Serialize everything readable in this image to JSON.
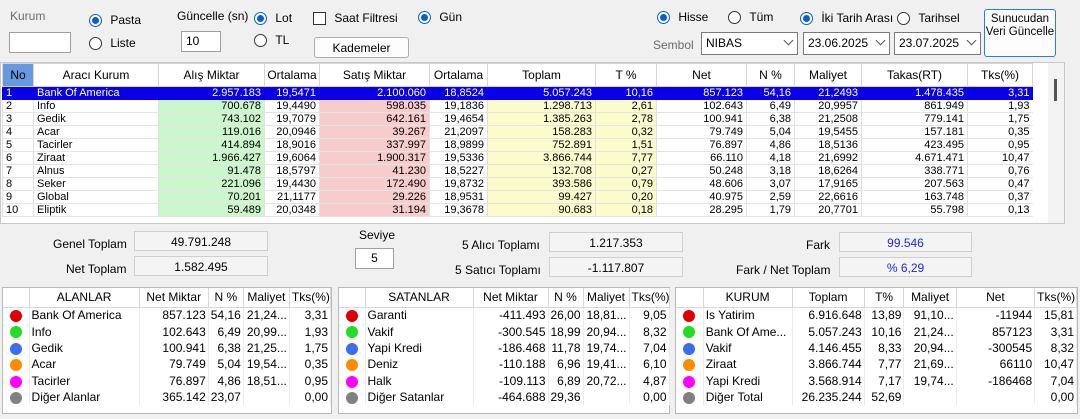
{
  "toolbar": {
    "kurum_label": "Kurum",
    "kurum_value": "",
    "pasta_label": "Pasta",
    "liste_label": "Liste",
    "guncelle_label": "Güncelle (sn)",
    "guncelle_value": "10",
    "lot_label": "Lot",
    "tl_label": "TL",
    "saat_filtresi_label": "Saat Filtresi",
    "gun_label": "Gün",
    "kademeler_label": "Kademeler",
    "hisse_label": "Hisse",
    "tum_label": "Tüm",
    "iki_tarih_label": "İki Tarih Arası",
    "tarihsel_label": "Tarihsel",
    "sembol_label": "Sembol",
    "sembol_value": "NIBAS",
    "date_from": "23.06.2025",
    "date_to": "23.07.2025",
    "server_btn": "Sunucudan Veri Güncelle"
  },
  "grid": {
    "headers": [
      "No",
      "Aracı Kurum",
      "Alış Miktar",
      "Ortalama",
      "Satış Miktar",
      "Ortalama",
      "Toplam",
      "T %",
      "Net",
      "N %",
      "Maliyet",
      "Takas(RT)",
      "Tks(%)"
    ],
    "rows": [
      [
        "1",
        "Bank Of America",
        "2.957.183",
        "19,5471",
        "2.100.060",
        "18,8524",
        "5.057.243",
        "10,16",
        "857.123",
        "54,16",
        "21,2493",
        "1.478.435",
        "3,31"
      ],
      [
        "2",
        "Info",
        "700.678",
        "19,4490",
        "598.035",
        "19,1836",
        "1.298.713",
        "2,61",
        "102.643",
        "6,49",
        "20,9957",
        "861.949",
        "1,93"
      ],
      [
        "3",
        "Gedik",
        "743.102",
        "19,7079",
        "642.161",
        "19,4654",
        "1.385.263",
        "2,78",
        "100.941",
        "6,38",
        "21,2508",
        "779.141",
        "1,75"
      ],
      [
        "4",
        "Acar",
        "119.016",
        "20,0946",
        "39.267",
        "21,2097",
        "158.283",
        "0,32",
        "79.749",
        "5,04",
        "19,5455",
        "157.181",
        "0,35"
      ],
      [
        "5",
        "Tacirler",
        "414.894",
        "18,9016",
        "337.997",
        "18,9899",
        "752.891",
        "1,51",
        "76.897",
        "4,86",
        "18,5136",
        "423.495",
        "0,95"
      ],
      [
        "6",
        "Ziraat",
        "1.966.427",
        "19,6064",
        "1.900.317",
        "19,5336",
        "3.866.744",
        "7,77",
        "66.110",
        "4,18",
        "21,6992",
        "4.671.471",
        "10,47"
      ],
      [
        "7",
        "Alnus",
        "91.478",
        "18,5797",
        "41.230",
        "18,5227",
        "132.708",
        "0,27",
        "50.248",
        "3,18",
        "18,6264",
        "338.771",
        "0,76"
      ],
      [
        "8",
        "Seker",
        "221.096",
        "19,4430",
        "172.490",
        "19,8732",
        "393.586",
        "0,79",
        "48.606",
        "3,07",
        "17,9165",
        "207.563",
        "0,47"
      ],
      [
        "9",
        "Global",
        "70.201",
        "21,1177",
        "29.226",
        "18,9531",
        "99.427",
        "0,20",
        "40.975",
        "2,59",
        "22,6616",
        "163.748",
        "0,37"
      ],
      [
        "10",
        "Eliptik",
        "59.489",
        "20,0348",
        "31.194",
        "19,3678",
        "90.683",
        "0,18",
        "28.295",
        "1,79",
        "20,7701",
        "55.798",
        "0,13"
      ]
    ]
  },
  "summary": {
    "genel_toplam_label": "Genel Toplam",
    "genel_toplam_value": "49.791.248",
    "net_toplam_label": "Net Toplam",
    "net_toplam_value": "1.582.495",
    "seviye_label": "Seviye",
    "seviye_value": "5",
    "alici_label": "5  Alıcı Toplamı",
    "alici_value": "1.217.353",
    "satici_label": "5  Satıcı Toplamı",
    "satici_value": "-1.117.807",
    "fark_label": "Fark",
    "fark_value": "99.546",
    "fark_net_label": "Fark / Net Toplam",
    "fark_net_value": "% 6,29"
  },
  "alanlar": {
    "headers": [
      "",
      "ALANLAR",
      "Net Miktar",
      "N %",
      "Maliyet",
      "Tks(%)"
    ],
    "rows": [
      {
        "color": "#e00000",
        "name": "Bank Of America",
        "net": "857.123",
        "n": "54,16",
        "maliyet": "21,24...",
        "tks": "3,31"
      },
      {
        "color": "#22dd22",
        "name": "Info",
        "net": "102.643",
        "n": "6,49",
        "maliyet": "20,99...",
        "tks": "1,93"
      },
      {
        "color": "#3a6cf0",
        "name": "Gedik",
        "net": "100.941",
        "n": "6,38",
        "maliyet": "21,25...",
        "tks": "1,75"
      },
      {
        "color": "#ff8c00",
        "name": "Acar",
        "net": "79.749",
        "n": "5,04",
        "maliyet": "19,54...",
        "tks": "0,35"
      },
      {
        "color": "#ff00ff",
        "name": "Tacirler",
        "net": "76.897",
        "n": "4,86",
        "maliyet": "18,51...",
        "tks": "0,95"
      },
      {
        "color": "#808080",
        "name": "Diğer Alanlar",
        "net": "365.142",
        "n": "23,07",
        "maliyet": "",
        "tks": "0,00"
      }
    ]
  },
  "satanlar": {
    "headers": [
      "",
      "SATANLAR",
      "Net Miktar",
      "N %",
      "Maliyet",
      "Tks(%)"
    ],
    "rows": [
      {
        "color": "#e00000",
        "name": "Garanti",
        "net": "-411.493",
        "n": "26,00",
        "maliyet": "18,81...",
        "tks": "9,05"
      },
      {
        "color": "#22dd22",
        "name": "Vakif",
        "net": "-300.545",
        "n": "18,99",
        "maliyet": "20,94...",
        "tks": "8,32"
      },
      {
        "color": "#3a6cf0",
        "name": "Yapi Kredi",
        "net": "-186.468",
        "n": "11,78",
        "maliyet": "19,74...",
        "tks": "7,04"
      },
      {
        "color": "#ff8c00",
        "name": "Deniz",
        "net": "-110.188",
        "n": "6,96",
        "maliyet": "19,41...",
        "tks": "6,10"
      },
      {
        "color": "#ff00ff",
        "name": "Halk",
        "net": "-109.113",
        "n": "6,89",
        "maliyet": "20,72...",
        "tks": "4,87"
      },
      {
        "color": "#808080",
        "name": "Diğer Satanlar",
        "net": "-464.688",
        "n": "29,36",
        "maliyet": "",
        "tks": "0,00"
      }
    ]
  },
  "kurum": {
    "headers": [
      "",
      "KURUM",
      "Toplam",
      "T%",
      "Maliyet",
      "Net",
      "Tks(%)"
    ],
    "rows": [
      {
        "color": "#e00000",
        "name": "Is Yatirim",
        "toplam": "6.916.648",
        "t": "13,89",
        "maliyet": "91,10...",
        "net": "-11944",
        "tks": "15,81"
      },
      {
        "color": "#22dd22",
        "name": "Bank Of Ame...",
        "toplam": "5.057.243",
        "t": "10,16",
        "maliyet": "21,24...",
        "net": "857123",
        "tks": "3,31"
      },
      {
        "color": "#3a6cf0",
        "name": "Vakif",
        "toplam": "4.146.455",
        "t": "8,33",
        "maliyet": "20,94...",
        "net": "-300545",
        "tks": "8,32"
      },
      {
        "color": "#ff8c00",
        "name": "Ziraat",
        "toplam": "3.866.744",
        "t": "7,77",
        "maliyet": "21,69...",
        "net": "66110",
        "tks": "10,47"
      },
      {
        "color": "#ff00ff",
        "name": "Yapi Kredi",
        "toplam": "3.568.914",
        "t": "7,17",
        "maliyet": "19,74...",
        "net": "-186468",
        "tks": "7,04"
      },
      {
        "color": "#808080",
        "name": "Diğer Total",
        "toplam": "26.235.244",
        "t": "52,69",
        "maliyet": "",
        "net": "",
        "tks": "0,00"
      }
    ]
  }
}
